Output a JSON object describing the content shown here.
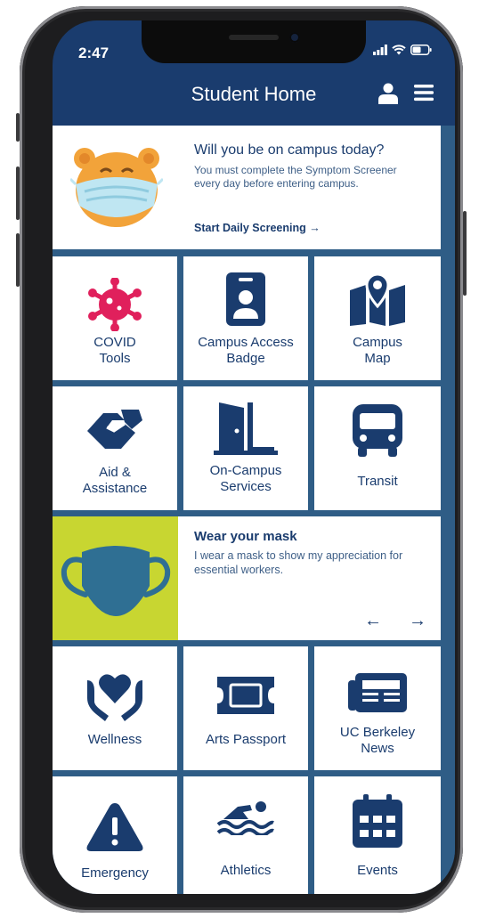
{
  "status": {
    "time": "2:47"
  },
  "header": {
    "title": "Student Home"
  },
  "screening": {
    "title": "Will you be on campus today?",
    "body": "You must complete the Symptom Screener every day before entering campus.",
    "cta": "Start Daily Screening →"
  },
  "tiles": [
    {
      "label": "COVID\nTools",
      "icon": "virus-icon"
    },
    {
      "label": "Campus Access\nBadge",
      "icon": "badge-icon"
    },
    {
      "label": "Campus\nMap",
      "icon": "map-icon"
    },
    {
      "label": "Aid &\nAssistance",
      "icon": "handshake-icon"
    },
    {
      "label": "On-Campus\nServices",
      "icon": "door-icon"
    },
    {
      "label": "Transit",
      "icon": "bus-icon"
    },
    {
      "label": "Wellness",
      "icon": "heart-hands-icon"
    },
    {
      "label": "Arts Passport",
      "icon": "ticket-icon"
    },
    {
      "label": "UC Berkeley\nNews",
      "icon": "newspaper-icon"
    },
    {
      "label": "Emergency",
      "icon": "warning-icon"
    },
    {
      "label": "Athletics",
      "icon": "swimmer-icon"
    },
    {
      "label": "Events",
      "icon": "calendar-icon"
    }
  ],
  "mask": {
    "title": "Wear your mask",
    "body": "I wear a mask to show my appreciation for essential workers.",
    "prev": "←",
    "next": "→"
  },
  "colors": {
    "navy": "#1a3c6e",
    "grid": "#2f5d86",
    "covid_pink": "#e0205c",
    "mask_yellow": "#c8d631",
    "mask_blue": "#2f6f93"
  }
}
